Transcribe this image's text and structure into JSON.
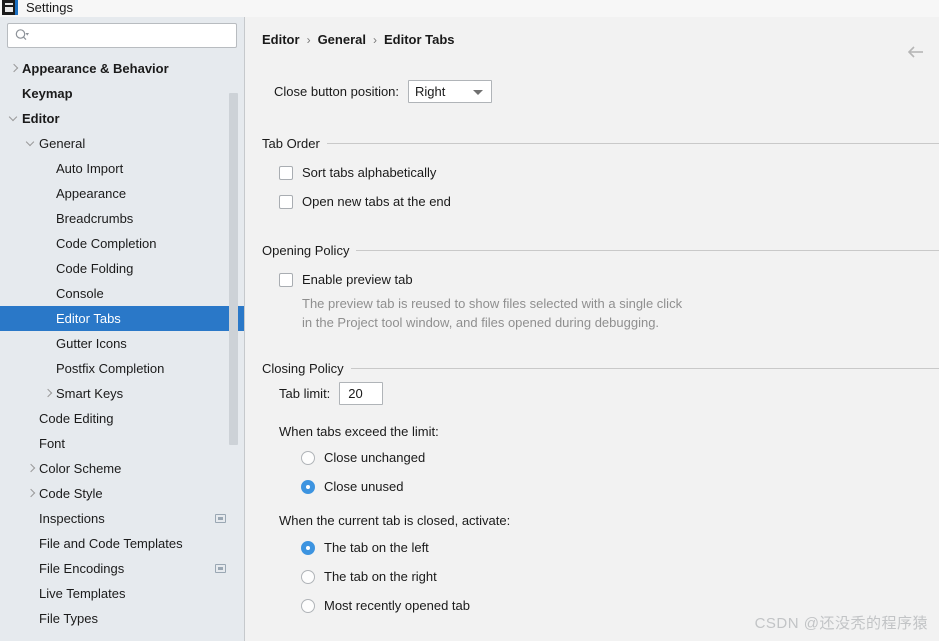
{
  "window": {
    "title": "Settings",
    "app_icon": "intellij-idea-icon"
  },
  "sidebar": {
    "search": {
      "value": "",
      "placeholder": "",
      "icon": "search-icon"
    },
    "items": [
      {
        "label": "Appearance & Behavior",
        "indent": 0,
        "twisty": "collapsed",
        "bold": true,
        "selected": false,
        "project_icon": false
      },
      {
        "label": "Keymap",
        "indent": 0,
        "twisty": "none",
        "bold": true,
        "selected": false,
        "project_icon": false
      },
      {
        "label": "Editor",
        "indent": 0,
        "twisty": "expanded",
        "bold": true,
        "selected": false,
        "project_icon": false
      },
      {
        "label": "General",
        "indent": 1,
        "twisty": "expanded",
        "bold": false,
        "selected": false,
        "project_icon": false
      },
      {
        "label": "Auto Import",
        "indent": 2,
        "twisty": "none",
        "bold": false,
        "selected": false,
        "project_icon": false
      },
      {
        "label": "Appearance",
        "indent": 2,
        "twisty": "none",
        "bold": false,
        "selected": false,
        "project_icon": false
      },
      {
        "label": "Breadcrumbs",
        "indent": 2,
        "twisty": "none",
        "bold": false,
        "selected": false,
        "project_icon": false
      },
      {
        "label": "Code Completion",
        "indent": 2,
        "twisty": "none",
        "bold": false,
        "selected": false,
        "project_icon": false
      },
      {
        "label": "Code Folding",
        "indent": 2,
        "twisty": "none",
        "bold": false,
        "selected": false,
        "project_icon": false
      },
      {
        "label": "Console",
        "indent": 2,
        "twisty": "none",
        "bold": false,
        "selected": false,
        "project_icon": false
      },
      {
        "label": "Editor Tabs",
        "indent": 2,
        "twisty": "none",
        "bold": false,
        "selected": true,
        "project_icon": false
      },
      {
        "label": "Gutter Icons",
        "indent": 2,
        "twisty": "none",
        "bold": false,
        "selected": false,
        "project_icon": false
      },
      {
        "label": "Postfix Completion",
        "indent": 2,
        "twisty": "none",
        "bold": false,
        "selected": false,
        "project_icon": false
      },
      {
        "label": "Smart Keys",
        "indent": 2,
        "twisty": "collapsed",
        "bold": false,
        "selected": false,
        "project_icon": false
      },
      {
        "label": "Code Editing",
        "indent": 1,
        "twisty": "none",
        "bold": false,
        "selected": false,
        "project_icon": false
      },
      {
        "label": "Font",
        "indent": 1,
        "twisty": "none",
        "bold": false,
        "selected": false,
        "project_icon": false
      },
      {
        "label": "Color Scheme",
        "indent": 1,
        "twisty": "collapsed",
        "bold": false,
        "selected": false,
        "project_icon": false
      },
      {
        "label": "Code Style",
        "indent": 1,
        "twisty": "collapsed",
        "bold": false,
        "selected": false,
        "project_icon": false
      },
      {
        "label": "Inspections",
        "indent": 1,
        "twisty": "none",
        "bold": false,
        "selected": false,
        "project_icon": true
      },
      {
        "label": "File and Code Templates",
        "indent": 1,
        "twisty": "none",
        "bold": false,
        "selected": false,
        "project_icon": false
      },
      {
        "label": "File Encodings",
        "indent": 1,
        "twisty": "none",
        "bold": false,
        "selected": false,
        "project_icon": true
      },
      {
        "label": "Live Templates",
        "indent": 1,
        "twisty": "none",
        "bold": false,
        "selected": false,
        "project_icon": false
      },
      {
        "label": "File Types",
        "indent": 1,
        "twisty": "none",
        "bold": false,
        "selected": false,
        "project_icon": false
      }
    ]
  },
  "main": {
    "breadcrumb": [
      "Editor",
      "General",
      "Editor Tabs"
    ],
    "breadcrumb_separator": "›",
    "back_icon": "back-arrow-icon",
    "close_button_position": {
      "label": "Close button position:",
      "value": "Right"
    },
    "tab_order": {
      "title": "Tab Order",
      "options": [
        {
          "label": "Sort tabs alphabetically",
          "checked": false
        },
        {
          "label": "Open new tabs at the end",
          "checked": false
        }
      ]
    },
    "opening_policy": {
      "title": "Opening Policy",
      "option": {
        "label": "Enable preview tab",
        "checked": false
      },
      "hint_line1": "The preview tab is reused to show files selected with a single click",
      "hint_line2": "in the Project tool window, and files opened during debugging."
    },
    "closing_policy": {
      "title": "Closing Policy",
      "tab_limit_label": "Tab limit:",
      "tab_limit_value": "20",
      "exceed_label": "When tabs exceed the limit:",
      "exceed_options": [
        {
          "label": "Close unchanged",
          "checked": false
        },
        {
          "label": "Close unused",
          "checked": true
        }
      ],
      "activate_label": "When the current tab is closed, activate:",
      "activate_options": [
        {
          "label": "The tab on the left",
          "checked": true
        },
        {
          "label": "The tab on the right",
          "checked": false
        },
        {
          "label": "Most recently opened tab",
          "checked": false
        }
      ]
    }
  },
  "watermark": {
    "text": "CSDN @还没秃的程序猿"
  },
  "colors": {
    "selection": "#2a78c8",
    "sidebar_bg": "#e6eaee",
    "panel_bg": "#f2f2f2",
    "radio_accent": "#3d94e0"
  }
}
